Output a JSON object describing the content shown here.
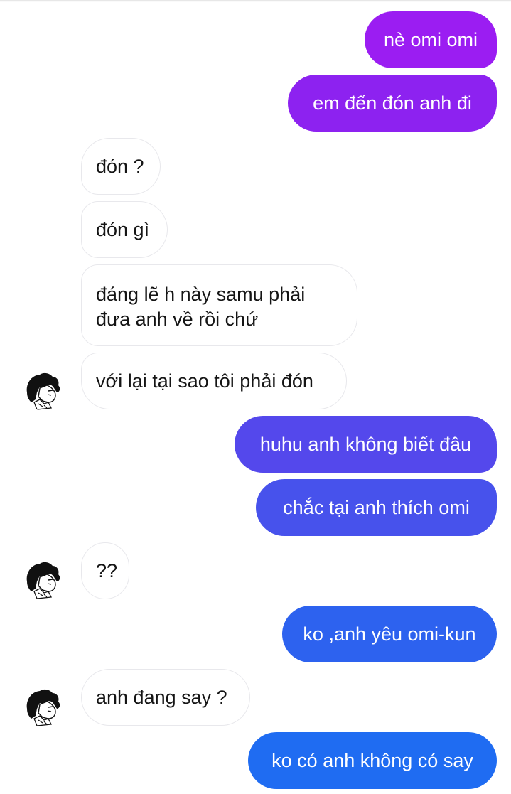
{
  "messages": [
    {
      "side": "out",
      "text": "nè omi omi",
      "color": "#9b1df2"
    },
    {
      "side": "out",
      "text": "em đến đón anh đi",
      "color": "#8d22f0"
    },
    {
      "side": "in",
      "text": "đón ?"
    },
    {
      "side": "in",
      "text": "đón gì"
    },
    {
      "side": "in",
      "text": "đáng lẽ h này samu phải đưa anh về rồi chứ"
    },
    {
      "side": "in",
      "text": "với lại tại sao tôi phải đón",
      "avatar": "anime-character-avatar"
    },
    {
      "side": "out",
      "text": "huhu anh không biết đâu",
      "color": "#5448ec"
    },
    {
      "side": "out",
      "text": "chắc tại anh thích omi",
      "color": "#4752ec"
    },
    {
      "side": "in",
      "text": "??",
      "avatar": "anime-character-avatar"
    },
    {
      "side": "out",
      "text": "ko ,anh yêu omi-kun",
      "color": "#2d62ef"
    },
    {
      "side": "in",
      "text": "anh đang say ?",
      "avatar": "anime-character-avatar"
    },
    {
      "side": "out",
      "text": "ko có anh không có say",
      "color": "#1f6cf2"
    }
  ]
}
